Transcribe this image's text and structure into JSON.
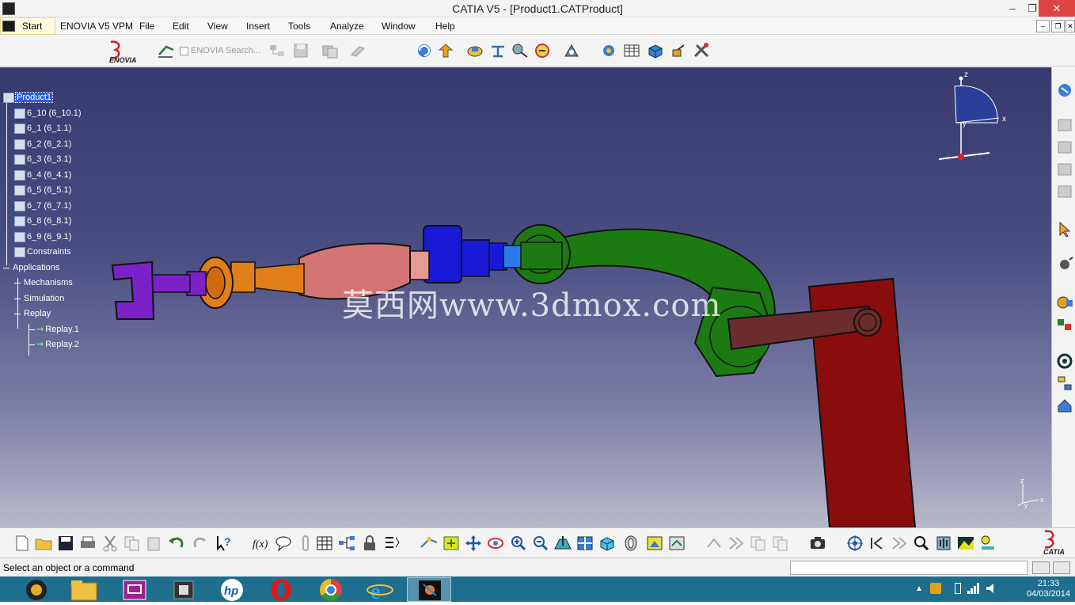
{
  "window": {
    "title": "CATIA V5 - [Product1.CATProduct]",
    "min": "‒",
    "max": "❐",
    "close": "✕"
  },
  "menu": {
    "start": "Start",
    "enovia": "ENOVIA V5 VPM",
    "file": "File",
    "edit": "Edit",
    "view": "View",
    "insert": "Insert",
    "tools": "Tools",
    "analyze": "Analyze",
    "window": "Window",
    "help": "Help"
  },
  "toolbar": {
    "enovia_search": "ENOVIA Search..."
  },
  "tree": {
    "root": "Product1",
    "parts": [
      "6_10 (6_10.1)",
      "6_1 (6_1.1)",
      "6_2 (6_2.1)",
      "6_3 (6_3.1)",
      "6_4 (6_4.1)",
      "6_5 (6_5.1)",
      "6_7 (6_7.1)",
      "6_8 (6_8.1)",
      "6_9 (6_9.1)"
    ],
    "constraints": "Constraints",
    "applications": "Applications",
    "mechanisms": "Mechanisms",
    "simulation": "Simulation",
    "replay": "Replay",
    "replay_items": [
      "Replay.1",
      "Replay.2"
    ]
  },
  "compass": {
    "z": "z",
    "x": "x",
    "y": "y"
  },
  "axis": {
    "z": "z",
    "x": "x",
    "y": "y"
  },
  "watermark": "莫西网www.3dmox.com",
  "status": {
    "text": "Select an object or a command",
    "input": ""
  },
  "clock": {
    "time": "21:33",
    "date": "04/03/2014"
  },
  "colors": {
    "bg_top": "#373a6e",
    "bg_bottom": "#b9b9cc",
    "arm_green": "#1b7a12",
    "base_red": "#8a0d0d",
    "link_pink": "#d57474",
    "joint_blue": "#1919d8",
    "gripper_purple": "#7a22c8",
    "wrist_orange": "#e07f1a"
  }
}
